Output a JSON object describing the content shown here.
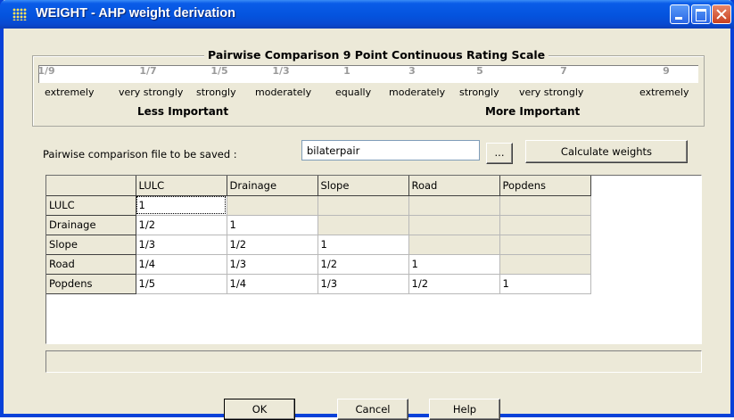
{
  "window": {
    "title": "WEIGHT - AHP weight derivation"
  },
  "scale": {
    "title": "Pairwise Comparison 9 Point Continuous Rating Scale",
    "values": [
      "1/9",
      "1/7",
      "1/5",
      "1/3",
      "1",
      "3",
      "5",
      "7",
      "9"
    ],
    "descriptors": [
      "extremely",
      "very strongly",
      "strongly",
      "moderately",
      "equally",
      "moderately",
      "strongly",
      "very strongly",
      "extremely"
    ],
    "less_label": "Less Important",
    "more_label": "More Important"
  },
  "file": {
    "label": "Pairwise comparison file to be saved :",
    "value": "bilaterpair",
    "browse_label": "...",
    "calculate_label": "Calculate weights"
  },
  "grid": {
    "columns": [
      "LULC",
      "Drainage",
      "Slope",
      "Road",
      "Popdens"
    ],
    "rows": [
      {
        "label": "LULC",
        "cells": [
          "1",
          "",
          "",
          "",
          ""
        ]
      },
      {
        "label": "Drainage",
        "cells": [
          "1/2",
          "1",
          "",
          "",
          ""
        ]
      },
      {
        "label": "Slope",
        "cells": [
          "1/3",
          "1/2",
          "1",
          "",
          ""
        ]
      },
      {
        "label": "Road",
        "cells": [
          "1/4",
          "1/3",
          "1/2",
          "1",
          ""
        ]
      },
      {
        "label": "Popdens",
        "cells": [
          "1/5",
          "1/4",
          "1/3",
          "1/2",
          "1"
        ]
      }
    ]
  },
  "buttons": {
    "ok": "OK",
    "cancel": "Cancel",
    "help": "Help"
  }
}
